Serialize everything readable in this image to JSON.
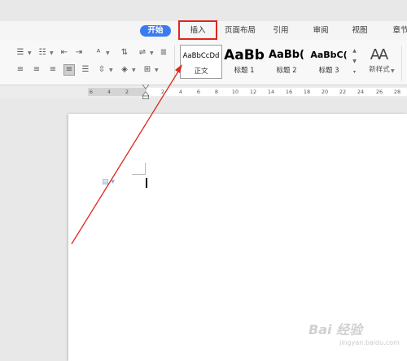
{
  "tabs": [
    {
      "label": "开始",
      "active": true
    },
    {
      "label": "插入",
      "highlighted": true
    },
    {
      "label": "页面布局"
    },
    {
      "label": "引用"
    },
    {
      "label": "审阅"
    },
    {
      "label": "视图"
    },
    {
      "label": "章节"
    }
  ],
  "ribbon": {
    "styles": [
      {
        "sample": "AaBbCcDd",
        "name": "正文"
      },
      {
        "sample": "AaBb",
        "name": "标题 1"
      },
      {
        "sample": "AaBb(",
        "name": "标题 2"
      },
      {
        "sample": "AaBbC(",
        "name": "标题 3"
      }
    ],
    "new_style_label": "新样式"
  },
  "ruler": {
    "ticks": [
      "6",
      "4",
      "2",
      "2",
      "4",
      "6",
      "8",
      "10",
      "12",
      "14",
      "16",
      "18",
      "20",
      "22",
      "24",
      "26",
      "28"
    ]
  },
  "watermark": {
    "main": "Bai 经验",
    "sub": "jingyan.baidu.com"
  },
  "colors": {
    "accent": "#3a7bf0",
    "annotation": "#e0261c"
  }
}
